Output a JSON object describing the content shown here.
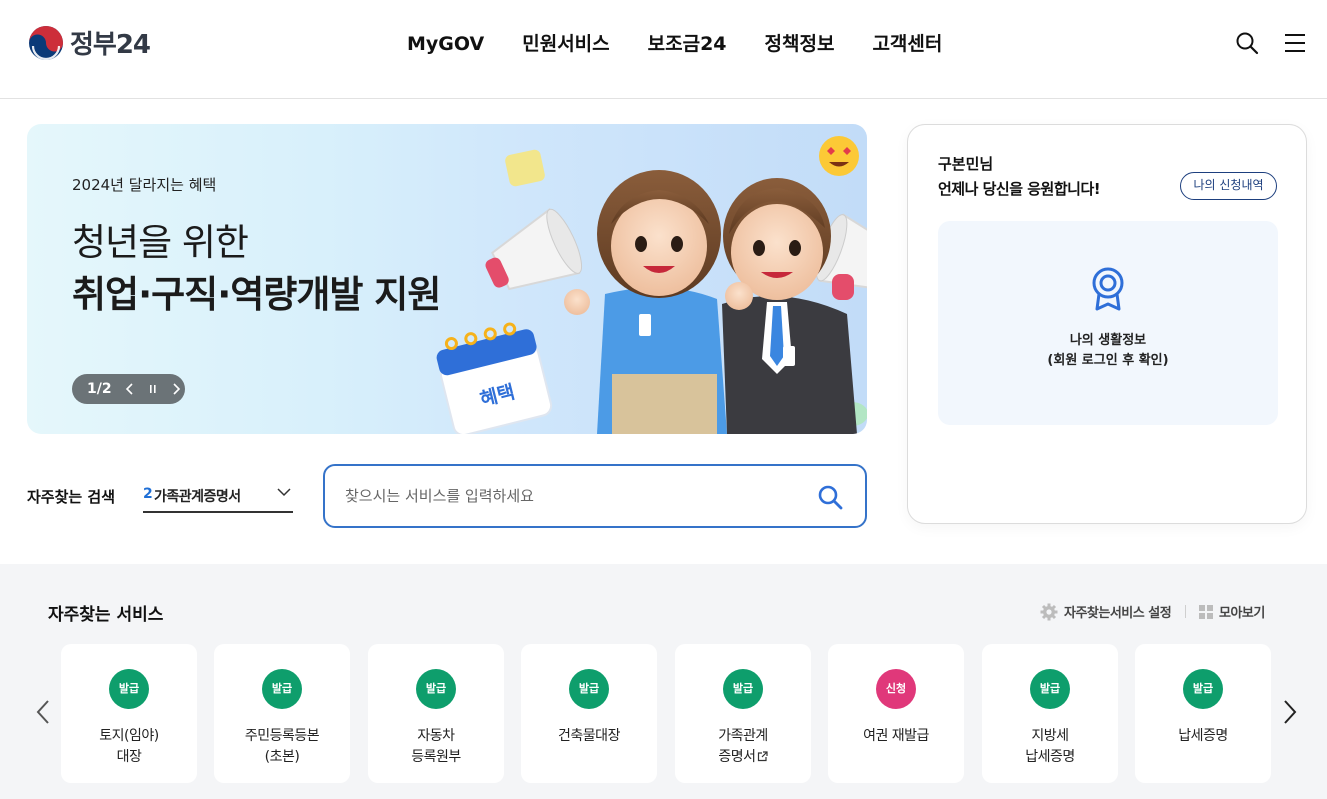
{
  "colors": {
    "accent": "#3573c9",
    "issue_badge": "#0e9e6c",
    "apply_badge": "#e0387a",
    "navy": "#1d3f7e"
  },
  "header": {
    "logo_text": "정부24",
    "nav": [
      "MyGOV",
      "민원서비스",
      "보조금24",
      "정책정보",
      "고객센터"
    ],
    "icons": [
      "search-icon",
      "hamburger-menu-icon"
    ]
  },
  "banner": {
    "subtitle": "2024년 달라지는 혜택",
    "title_line1": "청년을 위한",
    "title_line2": "취업·구직·역량개발 지원",
    "page_indicator": "1/2",
    "calendar_label": "혜택"
  },
  "search": {
    "favorite_label": "자주찾는 검색",
    "favorite_rank": "2",
    "favorite_value": "가족관계증명서",
    "placeholder": "찾으시는 서비스를 입력하세요"
  },
  "user_card": {
    "greeting_line1": "구본민님",
    "greeting_line2": "언제나 당신을 응원합니다!",
    "my_applications": "나의 신청내역",
    "life_info_title": "나의 생활정보",
    "life_info_note": "(회원 로그인 후 확인)"
  },
  "services": {
    "title": "자주찾는 서비스",
    "settings_label": "자주찾는서비스 설정",
    "view_all_label": "모아보기",
    "items": [
      {
        "badge": "발급",
        "line1": "토지(임야)",
        "line2": "대장"
      },
      {
        "badge": "발급",
        "line1": "주민등록등본",
        "line2": "(초본)"
      },
      {
        "badge": "발급",
        "line1": "자동차",
        "line2": "등록원부"
      },
      {
        "badge": "발급",
        "line1": "건축물대장",
        "line2": ""
      },
      {
        "badge": "발급",
        "line1": "가족관계",
        "line2": "증명서",
        "external": true
      },
      {
        "badge": "신청",
        "line1": "여권 재발급",
        "line2": ""
      },
      {
        "badge": "발급",
        "line1": "지방세",
        "line2": "납세증명"
      },
      {
        "badge": "발급",
        "line1": "납세증명",
        "line2": ""
      }
    ]
  }
}
